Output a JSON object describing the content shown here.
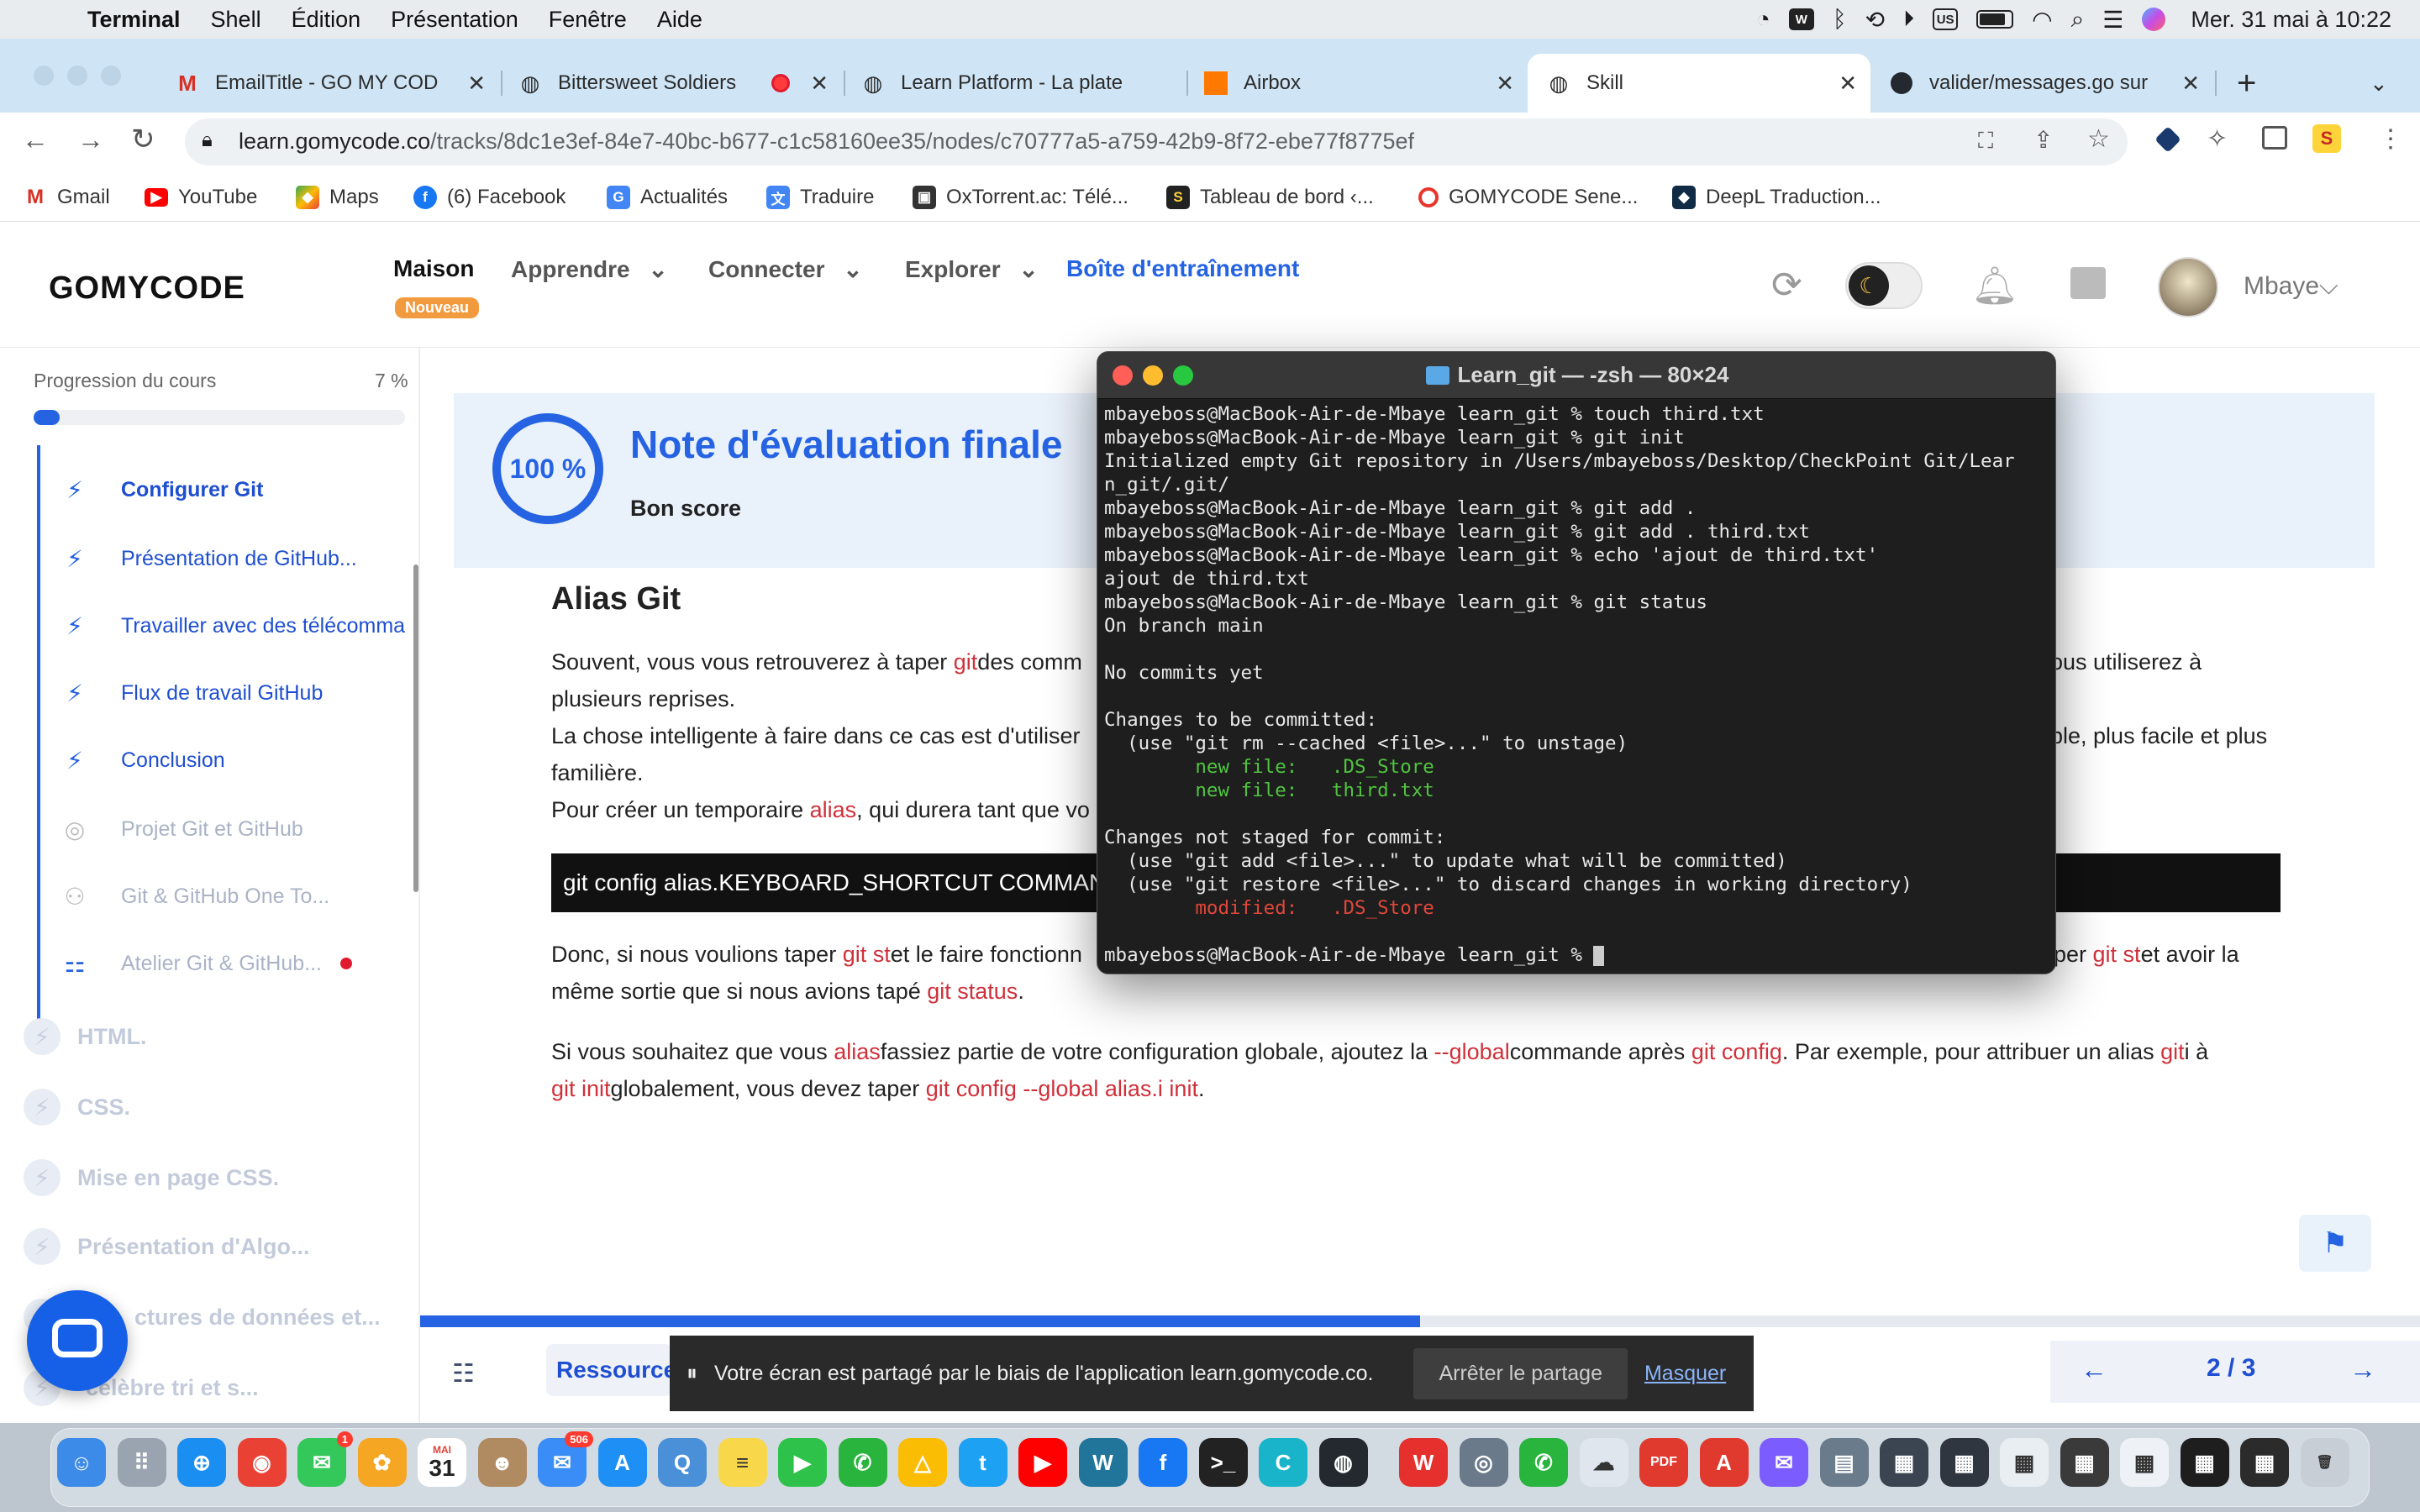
{
  "menubar": {
    "items": [
      "Terminal",
      "Shell",
      "Édition",
      "Présentation",
      "Fenêtre",
      "Aide"
    ],
    "input_badge": "US",
    "clock": "Mer. 31 mai à 10:22"
  },
  "tabs": [
    {
      "label": "EmailTitle - GO MY COD",
      "icon": "gmail-icon"
    },
    {
      "label": "Bittersweet Soldiers",
      "icon": "globe-icon"
    },
    {
      "label": "Learn Platform - La plate",
      "icon": "globe-icon"
    },
    {
      "label": "Airbox",
      "icon": "orange-icon"
    },
    {
      "label": "Skill",
      "icon": "globe-icon"
    },
    {
      "label": "valider/messages.go sur",
      "icon": "github-icon"
    }
  ],
  "address": {
    "host": "learn.gomycode.co",
    "path": "/tracks/8dc1e3ef-84e7-40bc-b677-c1c58160ee35/nodes/c70777a5-a759-42b9-8f72-ebe77f8775ef"
  },
  "bookmarks": [
    "Gmail",
    "YouTube",
    "Maps",
    "(6) Facebook",
    "Actualités",
    "Traduire",
    "OxTorrent.ac: Télé...",
    "Tableau de bord ‹...",
    "GOMYCODE Sene...",
    "DeepL Traduction..."
  ],
  "site": {
    "logo": "GOMYCODE",
    "nav": {
      "home": "Maison",
      "badge": "Nouveau",
      "learn": "Apprendre",
      "connect": "Connecter",
      "explore": "Explorer",
      "toolbox": "Boîte d'entraînement"
    },
    "user": "Mbaye"
  },
  "sidebar": {
    "progress_label": "Progression du cours",
    "progress_value": "7 %",
    "progress_fraction": 0.07,
    "lessons": [
      "Configurer Git",
      "Présentation de GitHub...",
      "Travailler avec des télécomma",
      "Flux de travail GitHub",
      "Conclusion",
      "Projet Git et GitHub",
      "Git & GitHub One To...",
      "Atelier Git & GitHub..."
    ],
    "modules": [
      "HTML.",
      "CSS.",
      "Mise en page CSS.",
      "Présentation d'Algo...",
      "ctures de données et...",
      "célèbre tri et s..."
    ]
  },
  "score": {
    "percent": "100 %",
    "title": "Note d'évaluation finale",
    "subtitle": "Bon score"
  },
  "article": {
    "heading": "Alias Git",
    "p1_a": "Souvent, vous vous retrouverez à taper ",
    "p1_git": "git",
    "p1_b": "des comm",
    "p1_c": "ous utiliserez à",
    "p1_d": "plusieurs reprises.",
    "p2_a": "La chose intelligente à faire dans ce cas est d'utiliser",
    "p2_b": "ple, plus facile et plus",
    "p2_c": "familière.",
    "p3_a": "Pour créer un temporaire ",
    "p3_alias": "alias",
    "p3_b": ", qui durera tant que vo",
    "code": "git config alias.KEYBOARD_SHORTCUT COMMAND",
    "p4_a": "Donc, si nous voulions taper ",
    "p4_gitst": "git st",
    "p4_b": "et le faire fonctionn",
    "p4_c": "per ",
    "p4_gitst2": "git st",
    "p4_d": "et avoir la",
    "p4_e": "même sortie que si nous avions tapé ",
    "p4_status": "git status",
    "p4_f": ".",
    "p5_a": "Si vous souhaitez que vous ",
    "p5_alias": "alias",
    "p5_b": "fassiez partie de votre configuration globale, ajoutez la ",
    "p5_global": "--global",
    "p5_c": "commande après ",
    "p5_config": "git config",
    "p5_d": ". Par exemple, pour attribuer un alias ",
    "p5_giti": "git",
    "p5_e": "i à",
    "p5_gitinit": "git init",
    "p5_f": "globalement, vous devez taper ",
    "p5_cmd": "git config --global alias.i init",
    "p5_g": "."
  },
  "bottom": {
    "resources": "Ressource",
    "page": "2 / 3",
    "lesson_progress": 0.5
  },
  "terminal": {
    "title": "Learn_git — -zsh — 80×24",
    "lines": [
      "mbayeboss@MacBook-Air-de-Mbaye learn_git % touch third.txt",
      "mbayeboss@MacBook-Air-de-Mbaye learn_git % git init",
      "Initialized empty Git repository in /Users/mbayeboss/Desktop/CheckPoint Git/Lear",
      "n_git/.git/",
      "mbayeboss@MacBook-Air-de-Mbaye learn_git % git add .",
      "mbayeboss@MacBook-Air-de-Mbaye learn_git % git add . third.txt",
      "mbayeboss@MacBook-Air-de-Mbaye learn_git % echo 'ajout de third.txt'",
      "ajout de third.txt",
      "mbayeboss@MacBook-Air-de-Mbaye learn_git % git status",
      "On branch main",
      "",
      "No commits yet",
      "",
      "Changes to be committed:",
      "  (use \"git rm --cached <file>...\" to unstage)",
      "        new file:   .DS_Store",
      "        new file:   third.txt",
      "",
      "Changes not staged for commit:",
      "  (use \"git add <file>...\" to update what will be committed)",
      "  (use \"git restore <file>...\" to discard changes in working directory)",
      "        modified:   .DS_Store",
      "",
      "mbayeboss@MacBook-Air-de-Mbaye learn_git % "
    ]
  },
  "share": {
    "message": "Votre écran est partagé par le biais de l'application learn.gomycode.co.",
    "stop": "Arrêter le partage",
    "hide": "Masquer"
  },
  "dock": {
    "calendar_month": "MAI",
    "calendar_day": "31",
    "mail_badge": "506",
    "messages_badge": "1"
  },
  "colors": {
    "accent": "#2563e3",
    "code_red": "#d0303a",
    "chrome_tabbar": "#cfe5f5",
    "terminal_bg": "#1e1e1e"
  }
}
